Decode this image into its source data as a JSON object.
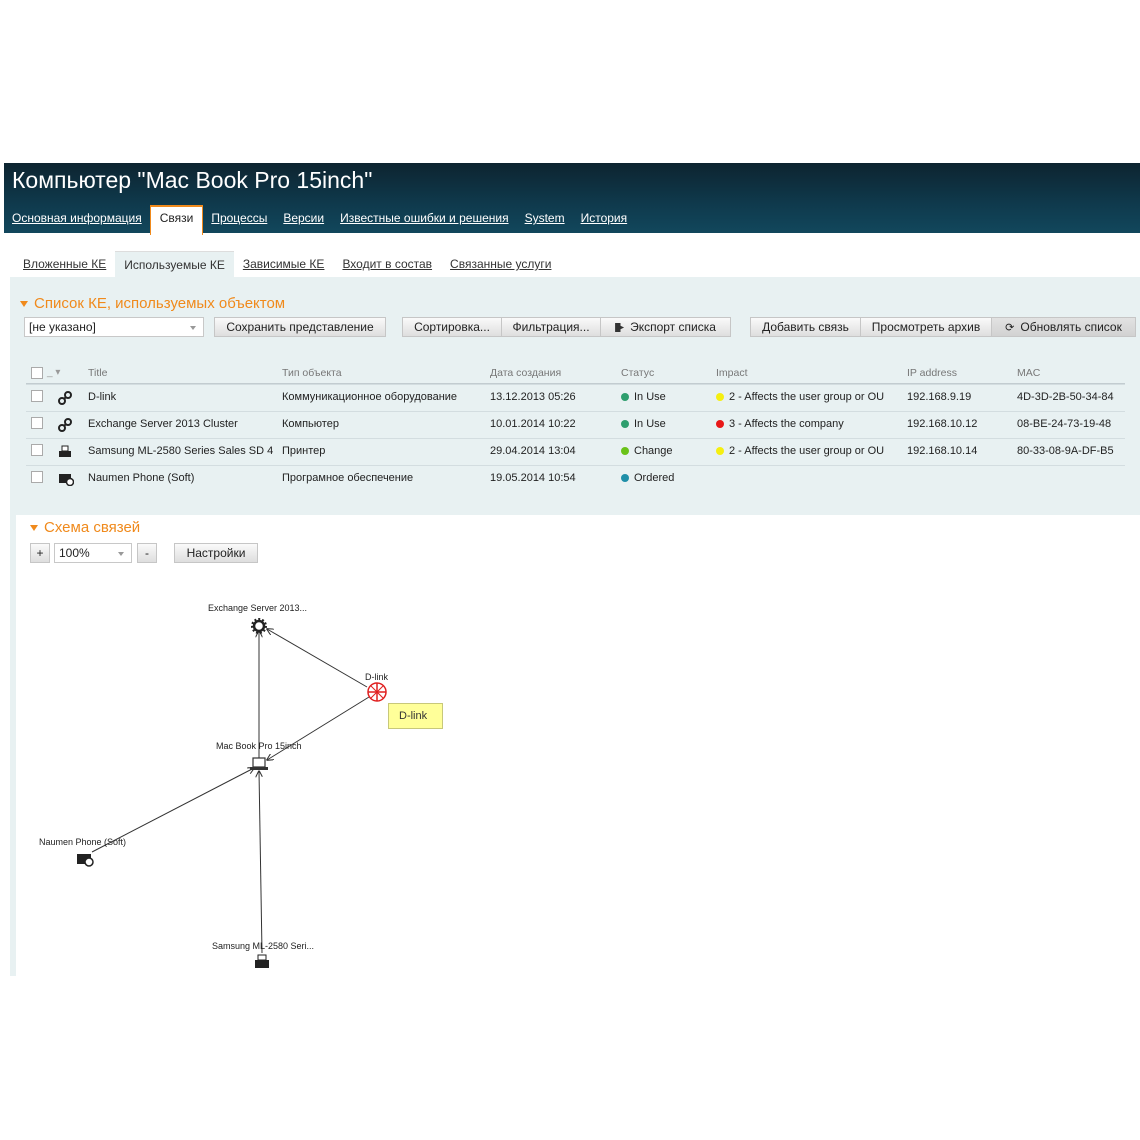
{
  "header": {
    "title": "Компьютер \"Mac Book Pro 15inch\"",
    "tabs": [
      "Основная информация",
      "Связи",
      "Процессы",
      "Версии",
      "Известные ошибки и решения",
      "System",
      "История"
    ],
    "active_tab": "Связи"
  },
  "subtabs": {
    "items": [
      "Вложенные КЕ",
      "Используемые КЕ",
      "Зависимые КЕ",
      "Входит в состав",
      "Связанные услуги"
    ],
    "active": "Используемые КЕ"
  },
  "list_section": {
    "title": "Список КЕ, используемых объектом",
    "view_select": "[не указано]",
    "buttons": {
      "save_view": "Сохранить представление",
      "sort": "Сортировка...",
      "filter": "Фильтрация...",
      "export": "Экспорт списка",
      "add_link": "Добавить связь",
      "view_archive": "Просмотреть архив",
      "refresh": "Обновлять список"
    },
    "columns": {
      "title": "Title",
      "type": "Тип объекта",
      "created": "Дата создания",
      "status": "Статус",
      "impact": "Impact",
      "ip": "IP address",
      "mac": "MAC"
    },
    "rows": [
      {
        "title": "D-link",
        "type": "Коммуникационное оборудование",
        "created": "13.12.2013 05:26",
        "status": "In Use",
        "status_color": "#2e9e6e",
        "impact": "2 - Affects the user group or OU",
        "impact_color": "#f5ef10",
        "ip": "192.168.9.19",
        "mac": "4D-3D-2B-50-34-84",
        "icon": "network-icon"
      },
      {
        "title": "Exchange Server 2013 Cluster",
        "type": "Компьютер",
        "created": "10.01.2014 10:22",
        "status": "In Use",
        "status_color": "#2e9e6e",
        "impact": "3 - Affects the company",
        "impact_color": "#e81818",
        "ip": "192.168.10.12",
        "mac": "08-BE-24-73-19-48",
        "icon": "network-icon"
      },
      {
        "title": "Samsung ML-2580 Series Sales SD 4",
        "type": "Принтер",
        "created": "29.04.2014 13:04",
        "status": "Change",
        "status_color": "#6ac219",
        "impact": "2 - Affects the user group or OU",
        "impact_color": "#f5ef10",
        "ip": "192.168.10.14",
        "mac": "80-33-08-9A-DF-B5",
        "icon": "printer-icon"
      },
      {
        "title": "Naumen Phone (Soft)",
        "type": "Програмное обеспечение",
        "created": "19.05.2014 10:54",
        "status": "Ordered",
        "status_color": "#1f8fa8",
        "impact": "",
        "impact_color": "",
        "ip": "",
        "mac": "",
        "icon": "software-icon"
      }
    ]
  },
  "schema_section": {
    "title": "Схема связей",
    "zoom_in": "+",
    "zoom_out": "-",
    "zoom": "100%",
    "settings": "Настройки",
    "nodes": {
      "exchange": "Exchange Server 2013...",
      "dlink": "D-link",
      "mac": "Mac Book Pro 15inch",
      "naumen": "Naumen Phone (Soft)",
      "samsung": "Samsung ML-2580 Seri..."
    },
    "tooltip": "D-link"
  },
  "colors": {
    "accent": "#f08a1c",
    "header_bg": "#0f3a4d",
    "panel_bg": "#e8f1f2"
  }
}
